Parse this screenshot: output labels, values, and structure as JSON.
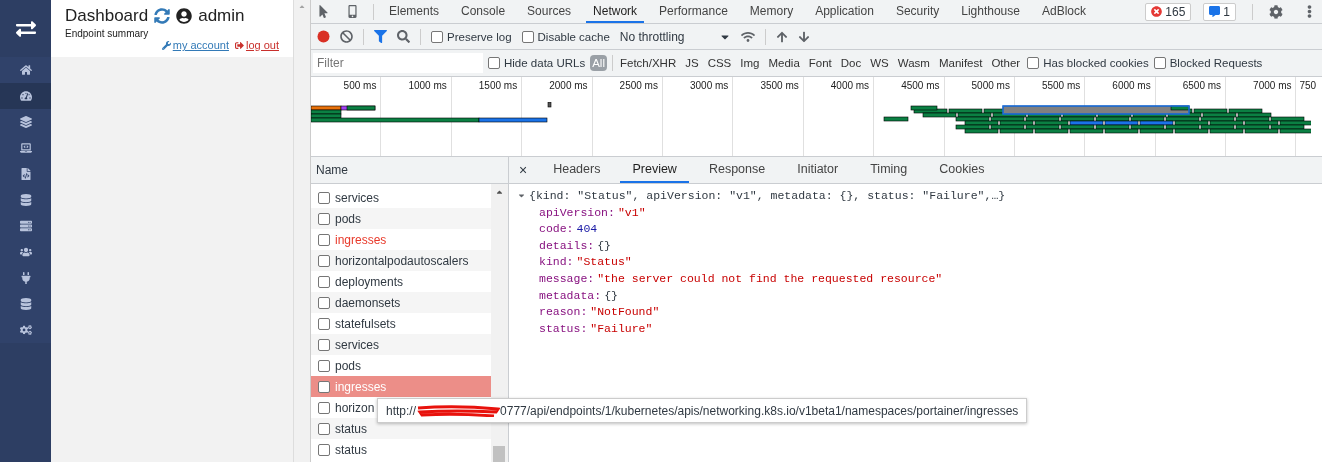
{
  "app": {
    "sidebar": [
      {
        "selected": false
      },
      {
        "selected": true
      },
      {
        "selected": false
      },
      {
        "selected": false
      },
      {
        "selected": false
      },
      {
        "selected": false
      },
      {
        "selected": false
      },
      {
        "selected": false
      },
      {
        "selected": false
      },
      {
        "selected": false
      },
      {
        "selected": false
      }
    ],
    "title": "Dashboard",
    "user": "admin",
    "subtitle": "Endpoint summary",
    "links": [
      {
        "kind": "account",
        "label": "my account"
      },
      {
        "kind": "logout",
        "label": "log out"
      }
    ]
  },
  "devtools": {
    "tabs": [
      {
        "label": "Elements",
        "selected": false
      },
      {
        "label": "Console",
        "selected": false
      },
      {
        "label": "Sources",
        "selected": false
      },
      {
        "label": "Network",
        "selected": true
      },
      {
        "label": "Performance",
        "selected": false
      },
      {
        "label": "Memory",
        "selected": false
      },
      {
        "label": "Application",
        "selected": false
      },
      {
        "label": "Security",
        "selected": false
      },
      {
        "label": "Lighthouse",
        "selected": false
      },
      {
        "label": "AdBlock",
        "selected": false
      }
    ],
    "errors": "165",
    "messages": "1",
    "toolbar": {
      "preserve_log": {
        "label": "Preserve log",
        "checked": false
      },
      "disable_cache": {
        "label": "Disable cache",
        "checked": false
      },
      "throttling": "No throttling"
    },
    "filter": {
      "placeholder": "Filter",
      "hide_data_urls": {
        "label": "Hide data URLs",
        "checked": false
      },
      "types": [
        {
          "label": "All",
          "selected": true
        },
        {
          "label": "Fetch/XHR",
          "selected": false
        },
        {
          "label": "JS",
          "selected": false
        },
        {
          "label": "CSS",
          "selected": false
        },
        {
          "label": "Img",
          "selected": false
        },
        {
          "label": "Media",
          "selected": false
        },
        {
          "label": "Font",
          "selected": false
        },
        {
          "label": "Doc",
          "selected": false
        },
        {
          "label": "WS",
          "selected": false
        },
        {
          "label": "Wasm",
          "selected": false
        },
        {
          "label": "Manifest",
          "selected": false
        },
        {
          "label": "Other",
          "selected": false
        }
      ],
      "extra": [
        {
          "label": "Has blocked cookies",
          "checked": false
        },
        {
          "label": "Blocked Requests",
          "checked": false
        }
      ]
    },
    "timeline": {
      "ticks": [
        "500 ms",
        "1000 ms",
        "1500 ms",
        "2000 ms",
        "2500 ms",
        "3000 ms",
        "3500 ms",
        "4000 ms",
        "4500 ms",
        "5000 ms",
        "5500 ms",
        "6000 ms",
        "6500 ms",
        "7000 ms",
        "750"
      ]
    },
    "name_header": "Name",
    "requests": [
      {
        "name": "services",
        "failed": false,
        "selected": false
      },
      {
        "name": "pods",
        "failed": false,
        "selected": false
      },
      {
        "name": "ingresses",
        "failed": true,
        "selected": false
      },
      {
        "name": "horizontalpodautoscalers",
        "failed": false,
        "selected": false
      },
      {
        "name": "deployments",
        "failed": false,
        "selected": false
      },
      {
        "name": "daemonsets",
        "failed": false,
        "selected": false
      },
      {
        "name": "statefulsets",
        "failed": false,
        "selected": false
      },
      {
        "name": "services",
        "failed": false,
        "selected": false
      },
      {
        "name": "pods",
        "failed": false,
        "selected": false
      },
      {
        "name": "ingresses",
        "failed": true,
        "selected": true
      },
      {
        "name": "horizon",
        "failed": false,
        "selected": false
      },
      {
        "name": "status",
        "failed": false,
        "selected": false
      },
      {
        "name": "status",
        "failed": false,
        "selected": false
      }
    ],
    "detail_close": "×",
    "detail_tabs": [
      {
        "label": "Headers",
        "selected": false
      },
      {
        "label": "Preview",
        "selected": true
      },
      {
        "label": "Response",
        "selected": false
      },
      {
        "label": "Initiator",
        "selected": false
      },
      {
        "label": "Timing",
        "selected": false
      },
      {
        "label": "Cookies",
        "selected": false
      }
    ],
    "preview": {
      "summary": "{kind: \"Status\", apiVersion: \"v1\", metadata: {}, status: \"Failure\",…}",
      "expanded": true,
      "fields": [
        {
          "key": "apiVersion:",
          "kind": "string",
          "value": "\"v1\""
        },
        {
          "key": "code:",
          "kind": "number",
          "value": "404"
        },
        {
          "key": "details:",
          "kind": "object",
          "value": "{}"
        },
        {
          "key": "kind:",
          "kind": "string",
          "value": "\"Status\""
        },
        {
          "key": "message:",
          "kind": "string",
          "value": "\"the server could not find the requested resource\""
        },
        {
          "key": "metadata:",
          "kind": "object",
          "value": "{}"
        },
        {
          "key": "reason:",
          "kind": "string",
          "value": "\"NotFound\""
        },
        {
          "key": "status:",
          "kind": "string",
          "value": "\"Failure\""
        }
      ]
    },
    "tooltip": {
      "prefix": "http://",
      "rest": "0777/api/endpoints/1/kubernetes/apis/networking.k8s.io/v1beta1/namespaces/portainer/ingresses"
    }
  }
}
